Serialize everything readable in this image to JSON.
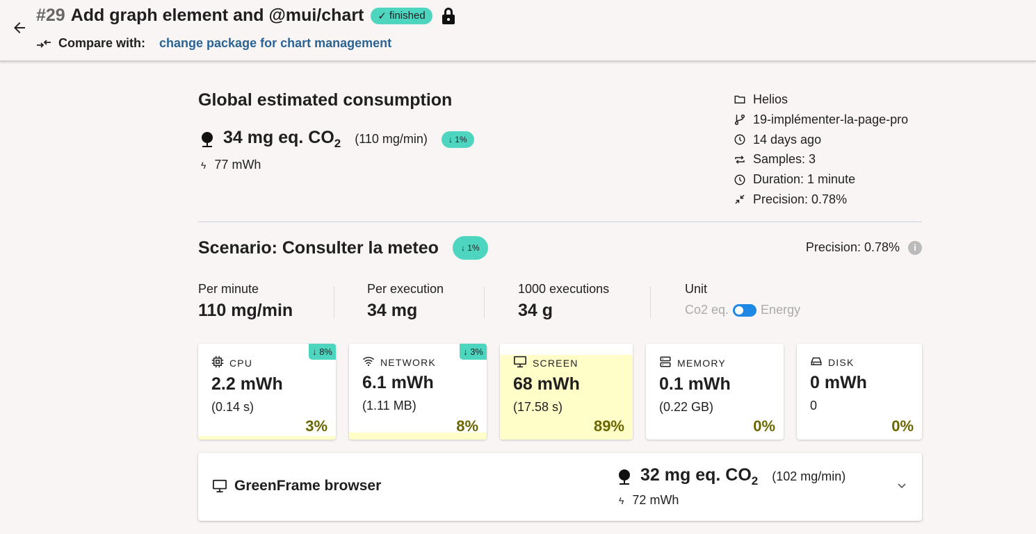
{
  "header": {
    "number": "#29",
    "title": "Add graph element and @mui/chart",
    "status": "finished",
    "compare_label": "Compare with:",
    "compare_link": "change package for chart management"
  },
  "global": {
    "title": "Global estimated consumption",
    "co2": "34 mg eq. CO",
    "co2_sub": "2",
    "rate": "(110 mg/min)",
    "delta": "↓ 1%",
    "energy": "77 mWh"
  },
  "meta": {
    "project": "Helios",
    "branch": "19-implémenter-la-page-pro",
    "date": "14 days ago",
    "samples": "Samples: 3",
    "duration": "Duration: 1 minute",
    "precision": "Precision: 0.78%"
  },
  "scenario": {
    "title": "Scenario: Consulter la meteo",
    "delta": "↓ 1%",
    "precision": "Precision: 0.78%",
    "stats": [
      {
        "label": "Per minute",
        "value": "110 mg/min"
      },
      {
        "label": "Per execution",
        "value": "34 mg"
      },
      {
        "label": "1000 executions",
        "value": "34 g"
      }
    ],
    "unit": {
      "label": "Unit",
      "left": "Co2 eq.",
      "right": "Energy"
    }
  },
  "cards": [
    {
      "name": "CPU",
      "icon": "cpu-icon",
      "value": "2.2 mWh",
      "sub": "(0.14 s)",
      "pct": "3%",
      "share": 3,
      "delta": "↓ 8%"
    },
    {
      "name": "NETWORK",
      "icon": "wifi-icon",
      "value": "6.1 mWh",
      "sub": "(1.11 MB)",
      "pct": "8%",
      "share": 8,
      "delta": "↓ 3%"
    },
    {
      "name": "SCREEN",
      "icon": "monitor-icon",
      "value": "68 mWh",
      "sub": "(17.58 s)",
      "pct": "89%",
      "share": 89,
      "delta": null
    },
    {
      "name": "MEMORY",
      "icon": "memory-icon",
      "value": "0.1 mWh",
      "sub": "(0.22 GB)",
      "pct": "0%",
      "share": 0,
      "delta": null
    },
    {
      "name": "DISK",
      "icon": "disk-icon",
      "value": "0 mWh",
      "sub": "0",
      "pct": "0%",
      "share": 0,
      "delta": null
    }
  ],
  "browser": {
    "name": "GreenFrame browser",
    "co2": "32 mg eq. CO",
    "co2_sub": "2",
    "rate": "(102 mg/min)",
    "energy": "72 mWh"
  },
  "colors": {
    "accent": "#4dd5c0",
    "link": "#2b6394",
    "fill": "#fffdc8",
    "pct": "#6b6700",
    "toggle": "#1e88e5"
  }
}
